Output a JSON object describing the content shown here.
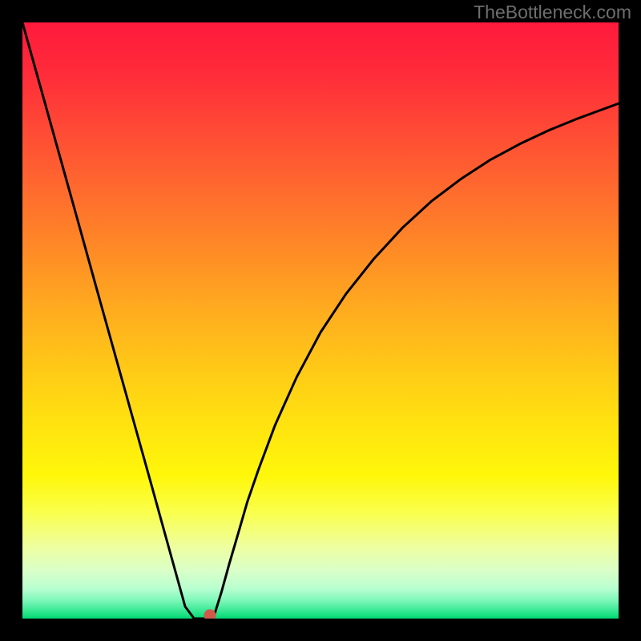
{
  "watermark": "TheBottleneck.com",
  "chart_data": {
    "type": "line",
    "title": "",
    "xlabel": "",
    "ylabel": "",
    "xlim": [
      0,
      100
    ],
    "ylim": [
      0,
      100
    ],
    "grid": false,
    "legend": false,
    "series": [
      {
        "name": "bottleneck-curve",
        "x": [
          0.0,
          3.1,
          6.2,
          9.3,
          12.4,
          15.5,
          18.6,
          21.7,
          24.8,
          27.3,
          28.8,
          30.1,
          31.2,
          32.0,
          33.4,
          34.7,
          36.2,
          37.7,
          39.6,
          42.4,
          46.0,
          50.0,
          54.3,
          59.0,
          63.8,
          68.6,
          73.5,
          78.4,
          83.4,
          88.3,
          93.2,
          97.0,
          100.0
        ],
        "y": [
          100.0,
          88.9,
          77.8,
          66.7,
          55.5,
          44.4,
          33.3,
          22.2,
          11.0,
          2.0,
          0.0,
          0.0,
          0.0,
          0.0,
          4.5,
          9.2,
          14.3,
          19.5,
          25.0,
          32.5,
          40.5,
          48.0,
          54.5,
          60.4,
          65.6,
          70.0,
          73.7,
          76.9,
          79.6,
          81.9,
          83.9,
          85.3,
          86.4
        ]
      }
    ],
    "marker": {
      "x": 31.5,
      "y": 0.0
    },
    "background_gradient": {
      "stops": [
        {
          "offset": 0,
          "color": "#ff1a3c"
        },
        {
          "offset": 50,
          "color": "#ffb31a"
        },
        {
          "offset": 80,
          "color": "#fff70a"
        },
        {
          "offset": 100,
          "color": "#00d873"
        }
      ]
    }
  }
}
